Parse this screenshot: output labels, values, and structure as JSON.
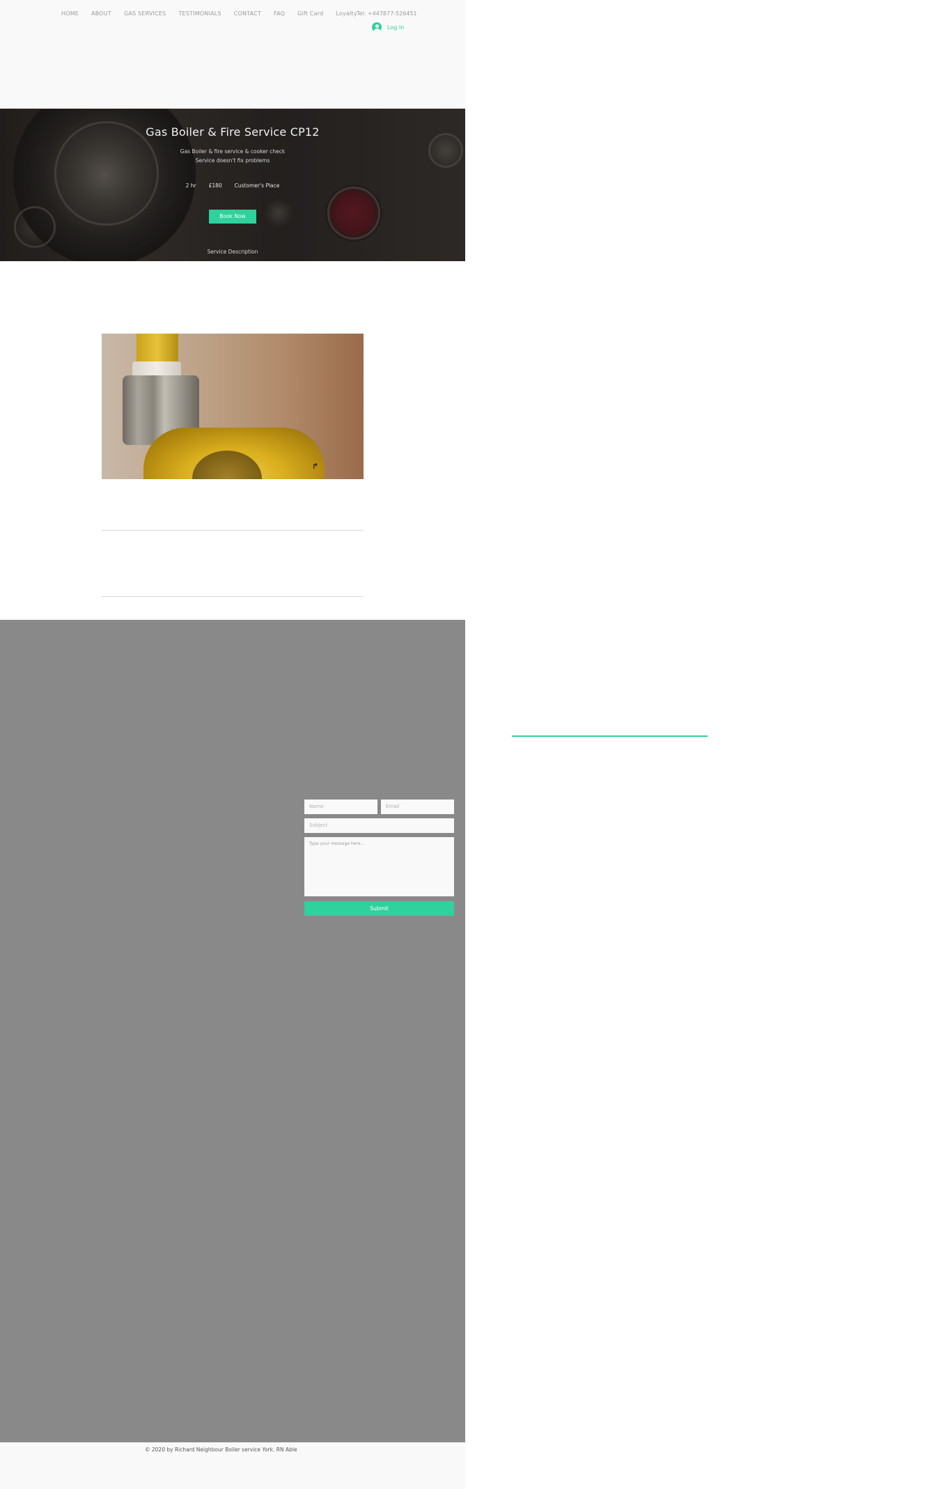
{
  "header": {
    "nav": [
      "HOME",
      "ABOUT",
      "GAS SERVICES",
      "TESTIMONIALS",
      "CONTACT",
      "FAQ",
      "Gift Card",
      "Loyalty"
    ],
    "phone": "Tel: +447877-526451",
    "login_label": "Log In"
  },
  "hero": {
    "title": "Gas Boiler & Fire Service CP12",
    "description_line1": "Gas Boiler & fire service & cooker check",
    "description_line2": "Service doesn't fix problems",
    "duration": "2 hr",
    "price": "£180",
    "location": "Customer's Place",
    "book_label": "Book Now",
    "service_description_label": "Service Description"
  },
  "contact_form": {
    "name_placeholder": "Name",
    "email_placeholder": "Email",
    "subject_placeholder": "Subject",
    "message_placeholder": "Type your message here...",
    "submit_label": "Submit"
  },
  "footer": {
    "copyright": "© 2020 by Richard Neighbour Boiler service York. RN Able"
  },
  "colors": {
    "accent": "#2fd19c",
    "gray_section": "#898989",
    "header_bg": "#f9f9f9"
  }
}
